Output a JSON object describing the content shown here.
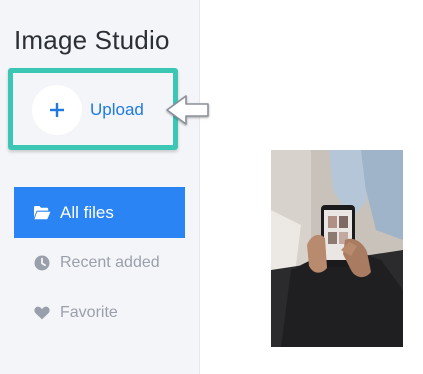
{
  "app": {
    "title": "Image Studio"
  },
  "upload": {
    "label": "Upload",
    "icon": "plus-icon"
  },
  "sidebar": {
    "items": [
      {
        "label": "All files",
        "icon": "folder-open-icon",
        "active": true
      },
      {
        "label": "Recent added",
        "icon": "clock-icon",
        "active": false
      },
      {
        "label": "Favorite",
        "icon": "heart-icon",
        "active": false
      }
    ]
  },
  "colors": {
    "accent": "#2b84f3",
    "highlight": "#3cc7b5",
    "upload_text": "#1f7ae0",
    "inactive_text": "#9aa0ab"
  }
}
